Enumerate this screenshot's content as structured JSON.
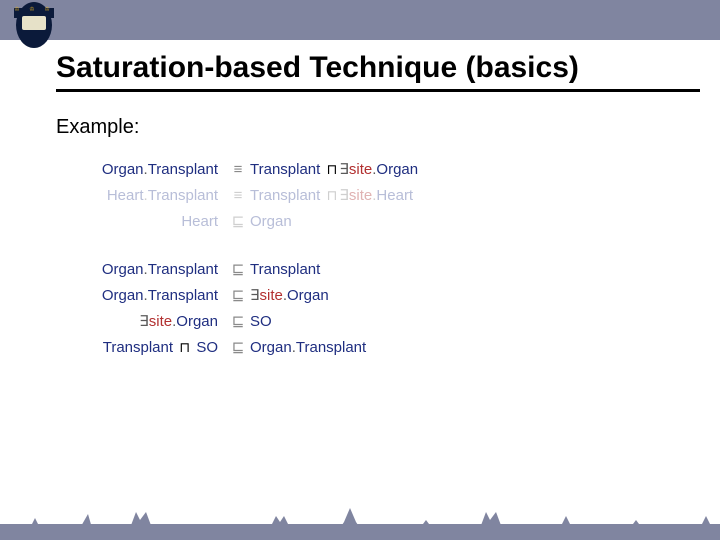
{
  "title": "Saturation-based Technique (basics)",
  "example_label": "Example:",
  "glyphs": {
    "equiv": "≡",
    "sub": "⊑",
    "sqcap": "⊓",
    "exists": "∃"
  },
  "group1": {
    "r1": {
      "lhs_a": "Organ",
      "lhs_dot1": ".",
      "lhs_b": "Transplant",
      "op_key": "equiv",
      "rhs_a": "Transplant",
      "rhs_role": "site",
      "rhs_dot2": ".",
      "rhs_c": "Organ"
    },
    "r2": {
      "lhs_a": "Heart",
      "lhs_dot1": ".",
      "lhs_b": "Transplant",
      "op_key": "equiv",
      "rhs_a": "Transplant",
      "rhs_role": "site",
      "rhs_dot2": ".",
      "rhs_c": "Heart"
    },
    "r3": {
      "lhs": "Heart",
      "op_key": "sub",
      "rhs": "Organ"
    }
  },
  "group2": {
    "r1": {
      "lhs_a": "Organ",
      "lhs_dot1": ".",
      "lhs_b": "Transplant",
      "op_key": "sub",
      "rhs": "Transplant"
    },
    "r2": {
      "lhs_a": "Organ",
      "lhs_dot1": ".",
      "lhs_b": "Transplant",
      "op_key": "sub",
      "rhs_role": "site",
      "rhs_dot2": ".",
      "rhs_c": "Organ"
    },
    "r3": {
      "lhs_role": "site",
      "lhs_dot": ".",
      "lhs_c": "Organ",
      "op_key": "sub",
      "rhs": "SO"
    },
    "r4": {
      "lhs_a": "Transplant",
      "lhs_b": "SO",
      "op_key": "sub",
      "rhs_a": "Organ",
      "rhs_dot": ".",
      "rhs_b": "Transplant"
    }
  }
}
